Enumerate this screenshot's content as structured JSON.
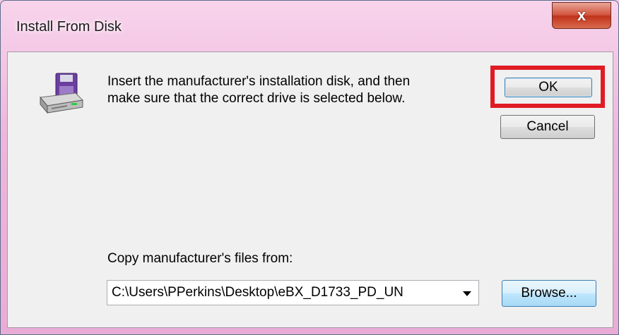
{
  "window": {
    "title": "Install From Disk"
  },
  "titlebar": {
    "close_label": "x"
  },
  "dialog": {
    "message_line1": "Insert the manufacturer's installation disk, and then",
    "message_line2": "make sure that the correct drive is selected below.",
    "ok_label": "OK",
    "cancel_label": "Cancel",
    "copy_label": "Copy manufacturer's files from:",
    "path_value": "C:\\Users\\PPerkins\\Desktop\\eBX_D1733_PD_UN",
    "browse_label": "Browse...",
    "icon": "disk-drive-icon"
  },
  "colors": {
    "highlight": "#e01b24",
    "titlebar": "#eeb6dc",
    "close": "#c0331a"
  }
}
